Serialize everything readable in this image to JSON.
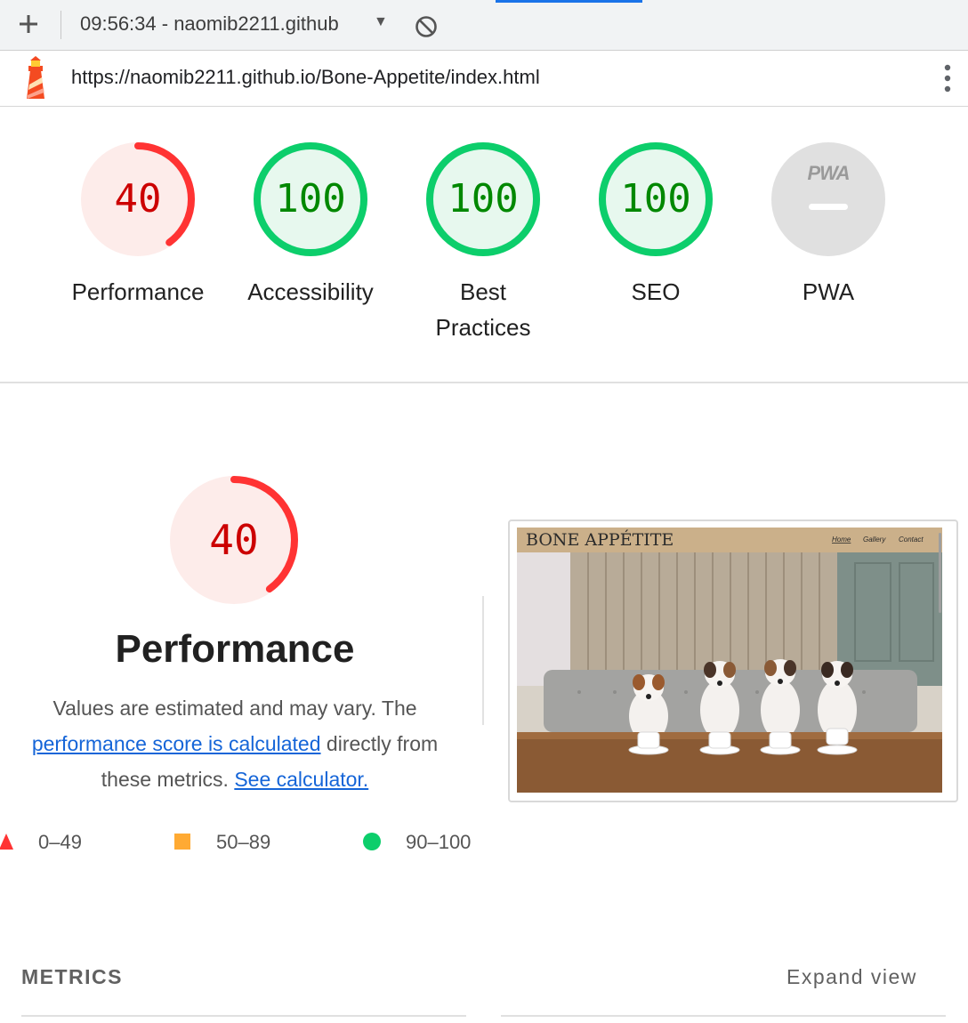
{
  "toolbar": {
    "report_select": "09:56:34 - naomib2211.github",
    "add_icon": "plus-icon",
    "block_icon": "block-icon"
  },
  "urlbar": {
    "url": "https://naomib2211.github.io/Bone-Appetite/index.html",
    "logo_icon": "lighthouse-icon",
    "menu_icon": "kebab-menu-icon"
  },
  "gauges": [
    {
      "score": "40",
      "label": "Performance",
      "fraction": 0.4,
      "status": "fail"
    },
    {
      "score": "100",
      "label": "Accessibility",
      "fraction": 1.0,
      "status": "pass"
    },
    {
      "score": "100",
      "label": "Best Practices",
      "label_line1": "Best",
      "label_line2": "Practices",
      "fraction": 1.0,
      "status": "pass"
    },
    {
      "score": "100",
      "label": "SEO",
      "fraction": 1.0,
      "status": "pass"
    },
    {
      "score": "",
      "label": "PWA",
      "badge": "PWA",
      "status": "na"
    }
  ],
  "performance": {
    "score": "40",
    "fraction": 0.4,
    "title": "Performance",
    "desc_1": "Values are estimated and may vary. The",
    "link_1": "performance score is calculated",
    "desc_2": "directly from",
    "desc_3": "these metrics.",
    "link_2": "See calculator."
  },
  "legend": [
    {
      "shape": "triangle",
      "range": "0–49",
      "color": "#ff3333"
    },
    {
      "shape": "square",
      "range": "50–89",
      "color": "#ffaa33"
    },
    {
      "shape": "circle",
      "range": "90–100",
      "color": "#0cce6b"
    }
  ],
  "thumbnail": {
    "site_title": "BONE APPÉTITE",
    "nav": [
      "Home",
      "Gallery",
      "Contact"
    ]
  },
  "metrics": {
    "title": "METRICS",
    "expand": "Expand view"
  },
  "colors": {
    "fail": "#ff3333",
    "fail_bg": "#fdecea",
    "fail_text": "#cc0000",
    "pass": "#0cce6b",
    "pass_bg": "#e7f8ee",
    "pass_text": "#008800",
    "na": "#e0e0e0"
  }
}
